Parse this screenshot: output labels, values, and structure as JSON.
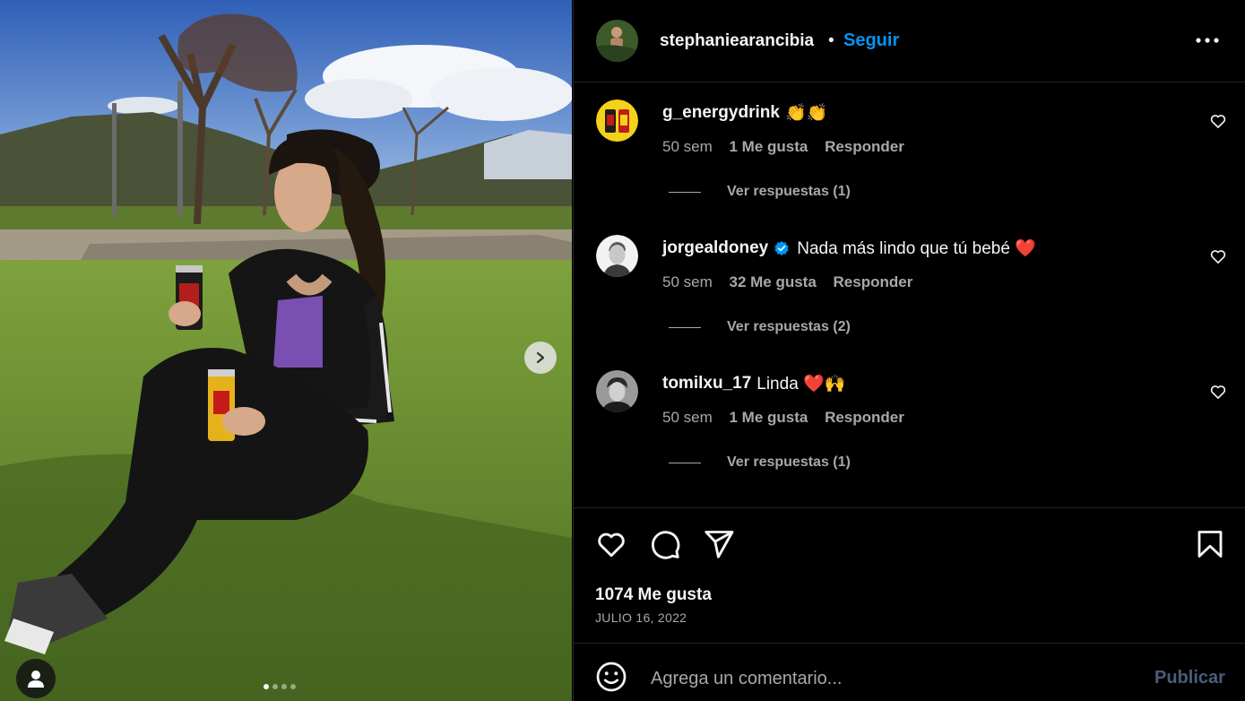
{
  "post": {
    "author": "stephaniearancibia",
    "separator": "•",
    "follow_label": "Seguir",
    "more_icon": "more-horizontal-icon",
    "likes": "1074 Me gusta",
    "date": "JULIO 16, 2022",
    "carousel": {
      "total": 4,
      "active": 0
    }
  },
  "comments": [
    {
      "username": "g_energydrink",
      "text": "👏👏",
      "verified": false,
      "time": "50 sem",
      "likes": "1 Me gusta",
      "reply": "Responder",
      "view_replies": "Ver respuestas (1)"
    },
    {
      "username": "jorgealdoney",
      "text": "Nada más lindo que tú bebé ❤️",
      "verified": true,
      "time": "50 sem",
      "likes": "32 Me gusta",
      "reply": "Responder",
      "view_replies": "Ver respuestas (2)"
    },
    {
      "username": "tomilxu_17",
      "text": "Linda ❤️🙌",
      "verified": false,
      "time": "50 sem",
      "likes": "1 Me gusta",
      "reply": "Responder",
      "view_replies": "Ver respuestas (1)"
    }
  ],
  "add_comment": {
    "placeholder": "Agrega un comentario...",
    "publish_label": "Publicar"
  },
  "colors": {
    "background": "#000000",
    "accent": "#0095f6",
    "muted": "#a8a8a8",
    "border": "#262626"
  }
}
